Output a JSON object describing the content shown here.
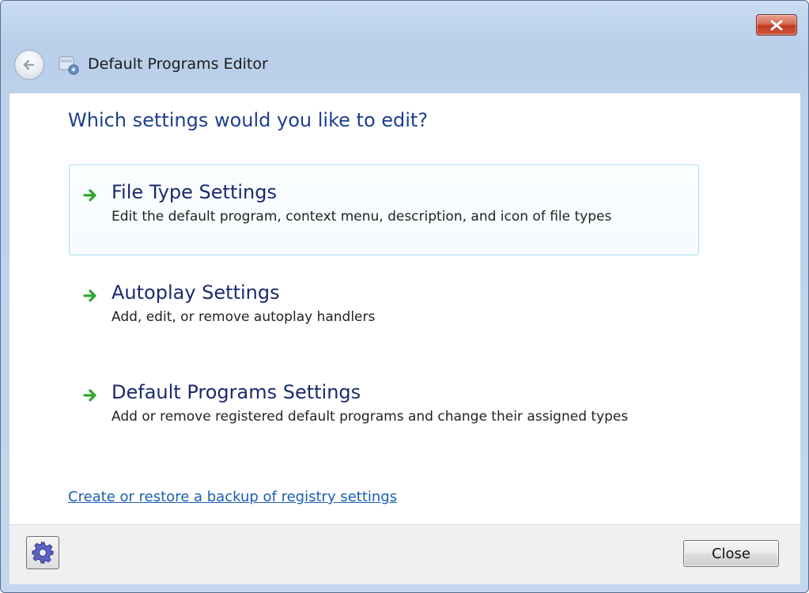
{
  "window": {
    "title": "Default Programs Editor",
    "close_glyph": "✕"
  },
  "main": {
    "heading": "Which settings would you like to edit?",
    "options": [
      {
        "title": "File Type Settings",
        "description": "Edit the default program, context menu, description, and icon of file types",
        "icon": "green-arrow-icon",
        "highlighted": true
      },
      {
        "title": "Autoplay Settings",
        "description": "Add, edit, or remove autoplay handlers",
        "icon": "green-arrow-icon",
        "highlighted": false
      },
      {
        "title": "Default Programs Settings",
        "description": "Add or remove registered default programs and change their assigned types",
        "icon": "green-arrow-icon",
        "highlighted": false
      }
    ],
    "backup_link": "Create or restore a backup of registry settings"
  },
  "footer": {
    "settings_icon": "gear-icon",
    "close_label": "Close"
  },
  "colors": {
    "heading": "#1e3f8f",
    "link": "#1a5fb4",
    "arrow": "#2ea82e",
    "highlight_border": "#a9dcf0",
    "titlebar": "#bcd1ea",
    "close_button": "#c0391f"
  }
}
